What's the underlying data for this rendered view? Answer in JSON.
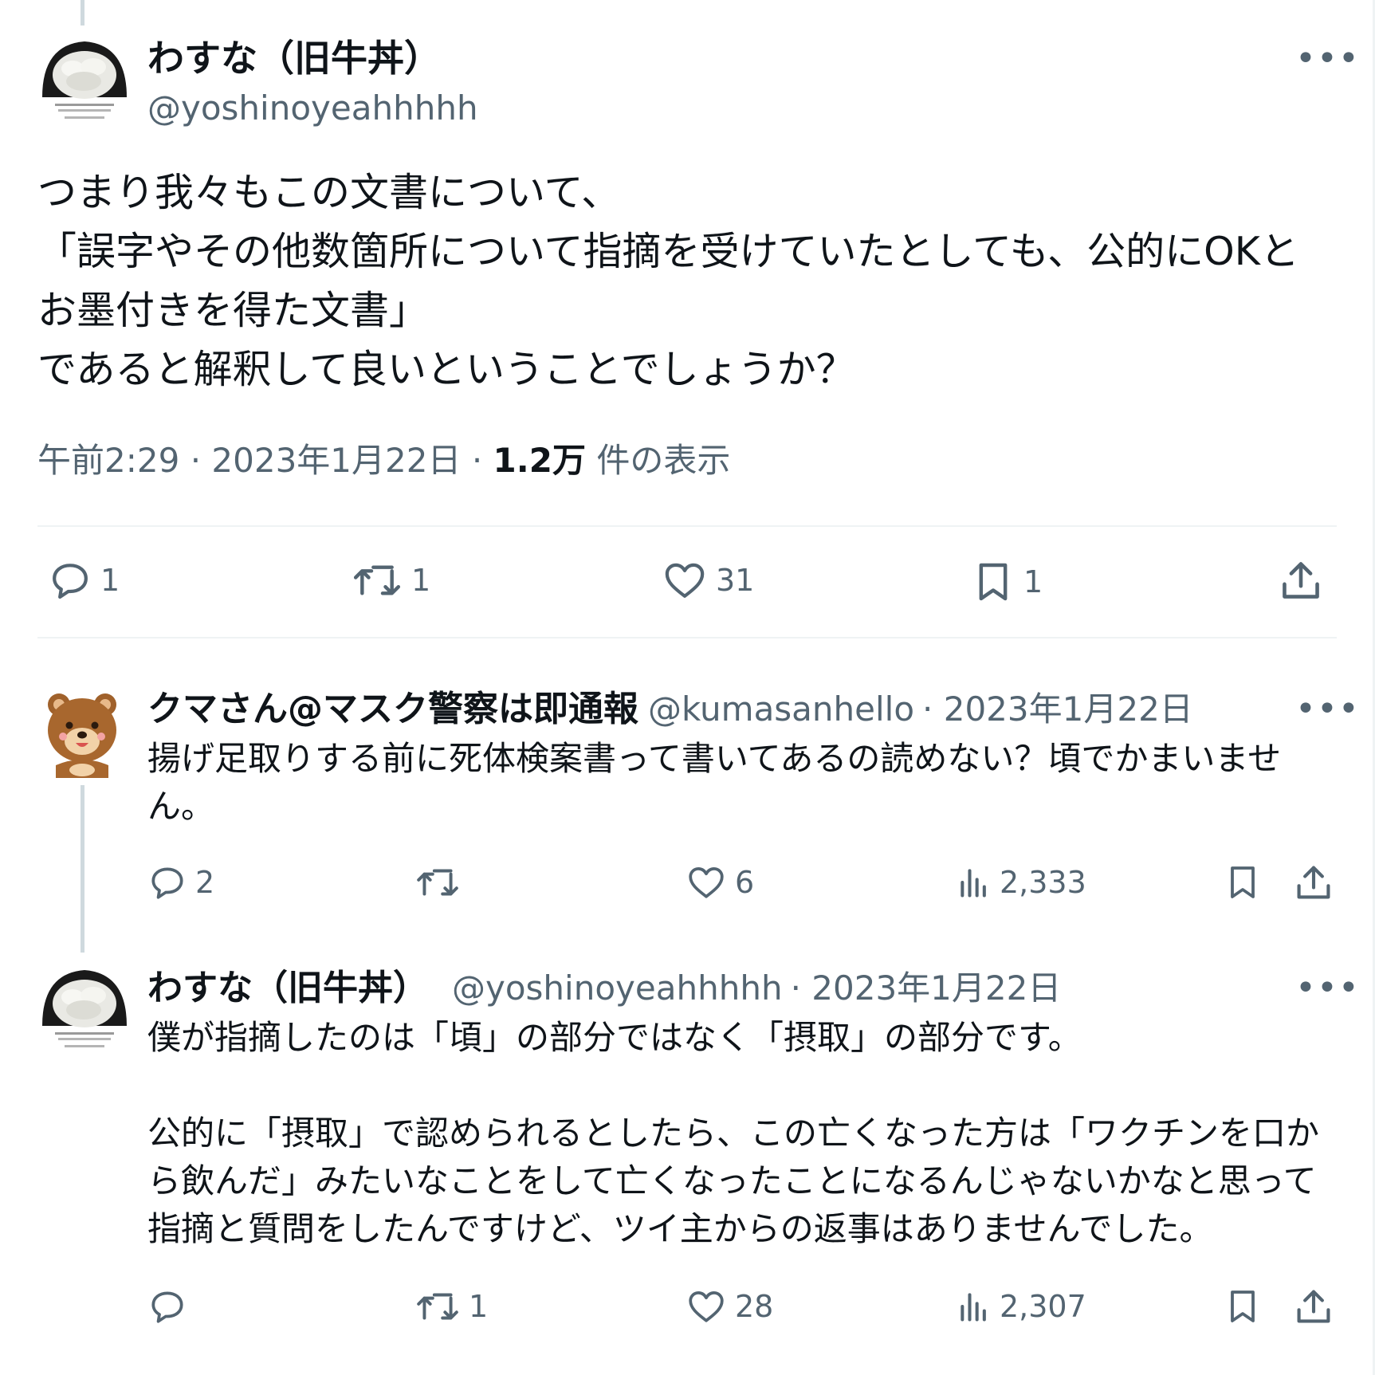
{
  "main_tweet": {
    "display_name": "わすな（旧牛丼）",
    "handle": "@yoshinoyeahhhhh",
    "more_label": "•••",
    "text": "つまり我々もこの文書について、\n「誤字やその他数箇所について指摘を受けていたとしても、公的にOKとお墨付きを得た文書」\nであると解釈して良いということでしょうか？",
    "time": "午前2:29",
    "date": "2023年1月22日",
    "separator": "·",
    "views_count": "1.2万",
    "views_label": "件の表示",
    "actions": {
      "reply": "1",
      "retweet": "1",
      "like": "31",
      "bookmark": "1"
    }
  },
  "replies": [
    {
      "display_name": "クマさん@マスク警察は即通報",
      "handle": "@kumasanhello",
      "date": "· 2023年1月22日",
      "more_label": "•••",
      "text": "揚げ足取りする前に死体検案書って書いてあるの読めない？頃でかまいません。",
      "actions": {
        "reply": "2",
        "retweet": "",
        "like": "6",
        "views": "2,333"
      }
    },
    {
      "display_name": "わすな（旧牛丼）",
      "handle": "@yoshinoyeahhhhh",
      "date": "· 2023年1月22日",
      "more_label": "•••",
      "text": "僕が指摘したのは「頃」の部分ではなく「摂取」の部分です。\n\n公的に「摂取」で認められるとしたら、この亡くなった方は「ワクチンを口から飲んだ」みたいなことをして亡くなったことになるんじゃないかなと思って指摘と質問をしたんですけど、ツイ主からの返事はありませんでした。",
      "actions": {
        "reply": "",
        "retweet": "1",
        "like": "28",
        "views": "2,307"
      }
    }
  ],
  "colors": {
    "text": "#0f1419",
    "secondary": "#536471",
    "divider": "#eff3f4",
    "thread_line": "#cfd9de"
  }
}
